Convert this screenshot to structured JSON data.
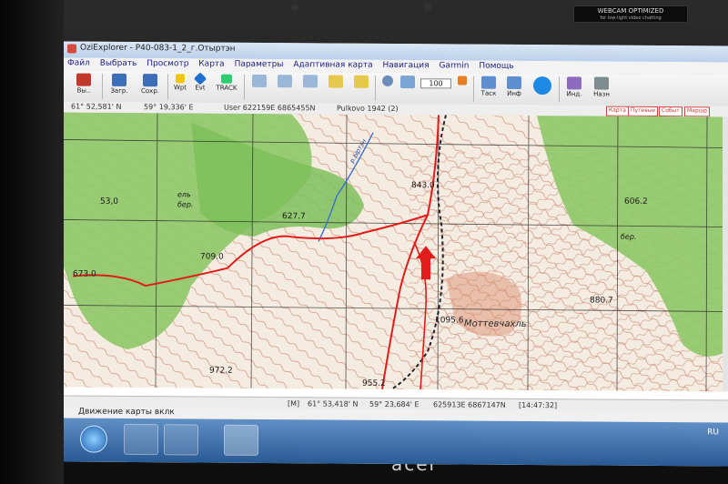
{
  "window": {
    "title": "OziExplorer - P40-083-1_2_г.Отыртэн"
  },
  "menu": [
    "Файл",
    "Выбрать",
    "Просмотр",
    "Карта",
    "Параметры",
    "Адаптивная карта",
    "Навигация",
    "Garmin",
    "Помощь"
  ],
  "toolbar": {
    "exit": "Вы..",
    "load": "Загр.",
    "save": "Сохр.",
    "wpt": "Wpt",
    "evt": "Evt",
    "track": "TRACK",
    "zoom": "100",
    "task": "Таск",
    "info": "Инф",
    "ind": "Инд.",
    "nav": "Назн"
  },
  "coords_top": {
    "lat": "61° 52,581' N",
    "lon": "59° 19,336' E",
    "user": "User  622159E    6865455N",
    "datum": "Pulkovo 1942 (2)"
  },
  "map_tabs": [
    "Карта",
    "Путевые",
    "Событ",
    "Маршр"
  ],
  "map_labels": {
    "h1": "53,0",
    "h2": "673.0",
    "h3": "709.0",
    "h4": "627.7",
    "h5": "843.0",
    "h6": "972.2",
    "h7": "1095.6",
    "h8": "955.2",
    "h9": "880.7",
    "h10": "606.2",
    "forest1": "ель",
    "forest2": "бер.",
    "forest3": "бер.",
    "peak": "Моттевчахль",
    "stream": "р.Ыртэн"
  },
  "status": {
    "mode": "[M]",
    "lat": "61° 53,418' N",
    "lon": "59° 23,684' E",
    "grid": "625913E   6867147N",
    "time": "[14:47:32]"
  },
  "message": "Движение карты вклк",
  "tray": {
    "lang": "RU"
  },
  "webcam": {
    "title": "WEBCAM OPTIMIZED",
    "sub": "for low-light video chatting"
  },
  "brand": "acer"
}
